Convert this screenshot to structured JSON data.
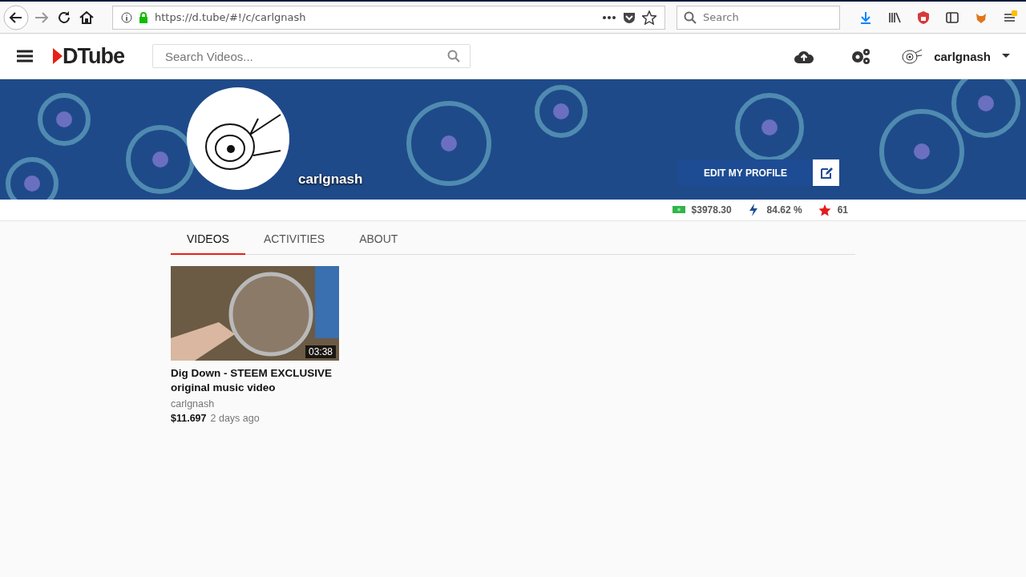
{
  "browser": {
    "url": "https://d.tube/#!/c/carlgnash",
    "search_placeholder": "Search"
  },
  "header": {
    "logo": "DTube",
    "search_placeholder": "Search Videos...",
    "username": "carlgnash"
  },
  "profile": {
    "name": "carlgnash",
    "edit_button": "EDIT MY PROFILE"
  },
  "stats": [
    {
      "kind": "money",
      "value": "$3978.30"
    },
    {
      "kind": "power",
      "value": "84.62 %"
    },
    {
      "kind": "reputation",
      "value": "61"
    }
  ],
  "tabs": [
    {
      "label": "VIDEOS",
      "selected": true
    },
    {
      "label": "ACTIVITIES",
      "selected": false
    },
    {
      "label": "ABOUT",
      "selected": false
    }
  ],
  "videos": [
    {
      "title": "Dig Down - STEEM EXCLUSIVE original music video",
      "author": "carlgnash",
      "duration": "03:38",
      "payout": "$11.697",
      "age": "2 days ago"
    }
  ]
}
